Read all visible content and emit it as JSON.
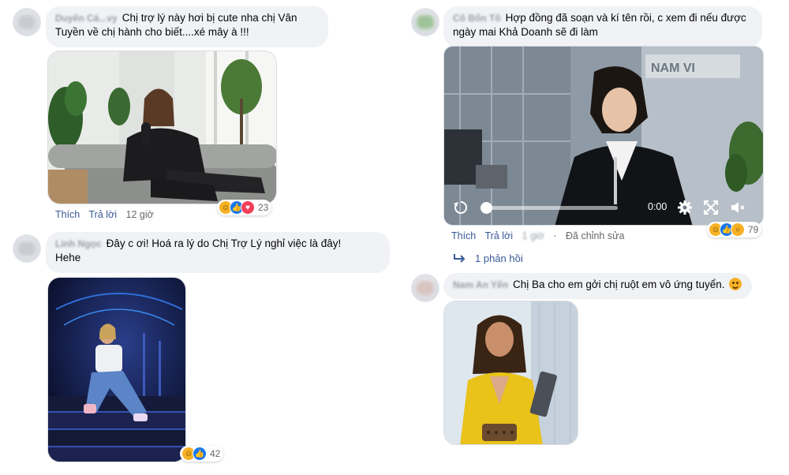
{
  "comments": [
    {
      "name": "Duyên Cá...vy",
      "text": "Chị trợ lý này hơi bị cute nha chị Vân Tuyền về chị hành cho biết....xé mây à !!!",
      "line1": "Chị trợ lý này hơi bị cute nha chị Vân",
      "line2": "Tuyền về chị hành cho biết....xé mây à !!!",
      "like_label": "Thích",
      "reply_label": "Trả lời",
      "time": "12 giờ",
      "reaction_count": "23"
    },
    {
      "name": "Linh Ngọc",
      "line1": "Đây c ơi! Hoá ra lý do Chị Trợ Lý nghỉ việc là đây!",
      "line2": "Hehe",
      "reaction_count": "42"
    },
    {
      "name": "Cô Bốn Tô",
      "line1": "Hợp đồng đã soạn và kí tên rồi, c xem đi nếu được",
      "line2": "ngày mai Khả Doanh sẽ đi làm",
      "like_label": "Thích",
      "reply_label": "Trả lời",
      "time": "1 giờ",
      "edited": "Đã chỉnh sửa",
      "reaction_count": "79",
      "replies_label": "1 phản hồi",
      "video": {
        "time": "0:00",
        "watermark": "NAM VI",
        "progress": 0.0
      }
    },
    {
      "name": "Nam An Yến",
      "line1": "Chị Ba cho em gởi chị ruột em vô ứng tuyển."
    }
  ],
  "icons": {
    "reply_arrow": "reply-arrow-icon",
    "replay": "replay-icon",
    "settings": "gear-icon",
    "fullscreen": "fullscreen-icon",
    "mute": "volume-mute-icon"
  },
  "colors": {
    "bubble": "#f0f2f5",
    "link": "#385898",
    "meta": "#65676b"
  }
}
